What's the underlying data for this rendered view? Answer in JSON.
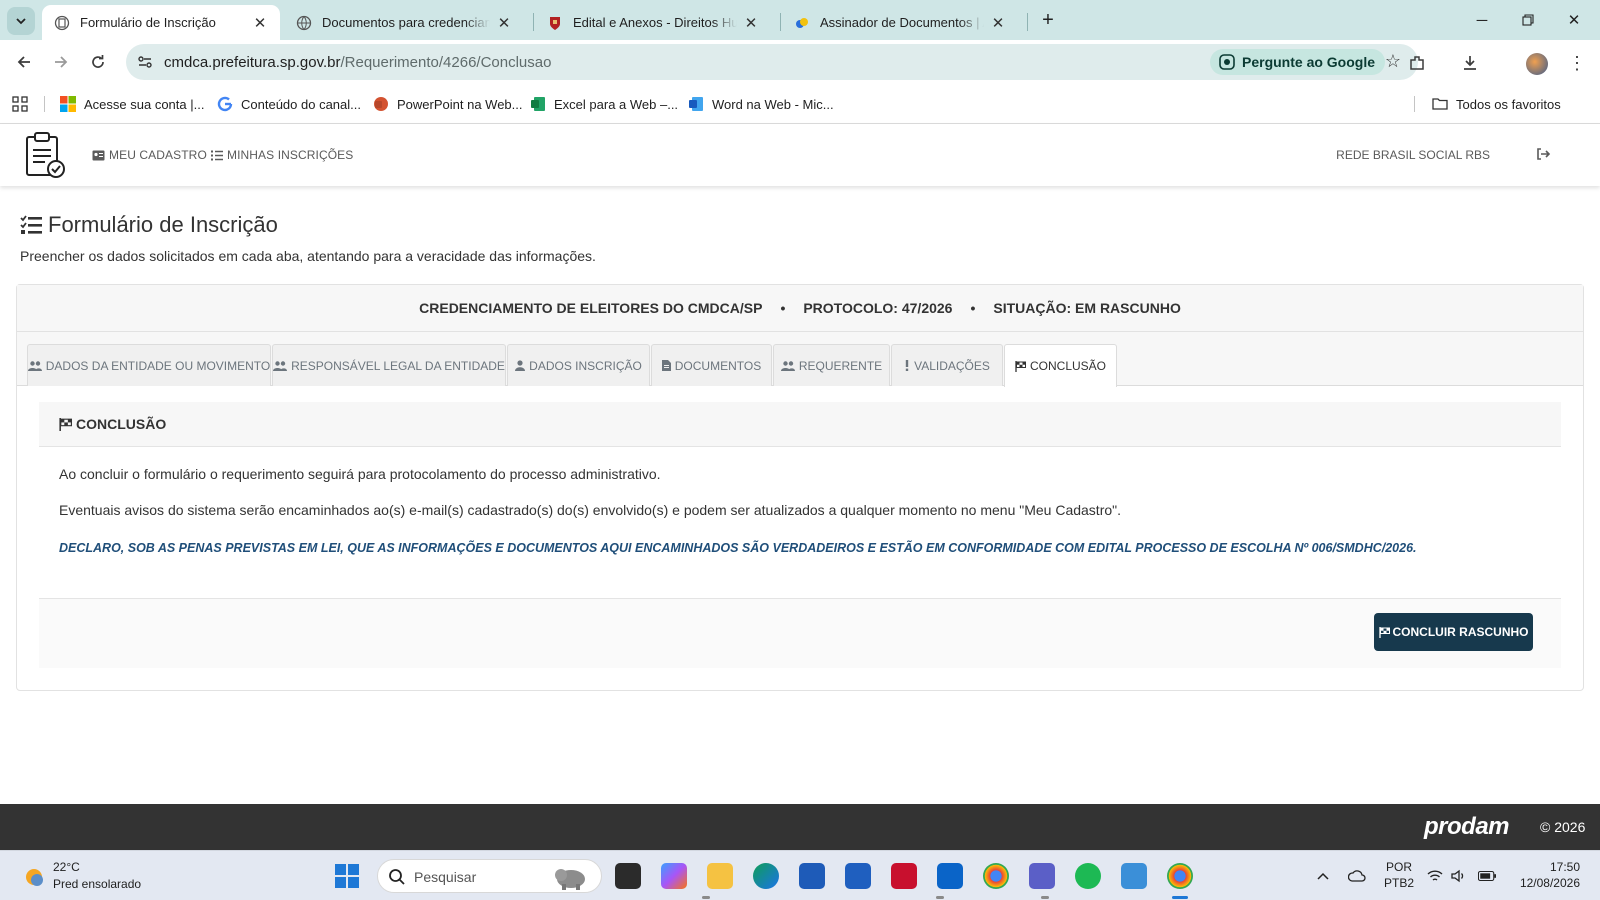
{
  "browser": {
    "tabs": [
      {
        "title": "Formulário de Inscrição",
        "active": true
      },
      {
        "title": "Documentos para credenciamento",
        "active": false
      },
      {
        "title": "Edital e Anexos - Direitos Humanos",
        "active": false
      },
      {
        "title": "Assinador de Documentos | Assinatura",
        "active": false
      }
    ],
    "url_host": "cmdca.prefeitura.sp.gov.br",
    "url_path": "/Requerimento/4266/Conclusao",
    "ask_google": "Pergunte ao Google",
    "bookmarks": [
      {
        "label": "Acesse sua conta |..."
      },
      {
        "label": "Conteúdo do canal..."
      },
      {
        "label": "PowerPoint na Web..."
      },
      {
        "label": "Excel para a Web –..."
      },
      {
        "label": "Word na Web - Mic..."
      }
    ],
    "all_bookmarks": "Todos os favoritos"
  },
  "site": {
    "nav": {
      "my_registration": "MEU CADASTRO",
      "my_subscriptions": "MINHAS INSCRIÇÕES",
      "user": "REDE BRASIL SOCIAL RBS"
    },
    "page_title": "Formulário de Inscrição",
    "page_subtitle": "Preencher os dados solicitados em cada aba, atentando para a veracidade das informações.",
    "header": {
      "process": "CREDENCIAMENTO DE ELEITORES DO CMDCA/SP",
      "sep": "•",
      "protocol": "PROTOCOLO: 47/2026",
      "status": "SITUAÇÃO: EM RASCUNHO"
    },
    "tabs": [
      {
        "label": "DADOS DA ENTIDADE OU MOVIMENTO",
        "icon": "users-icon"
      },
      {
        "label": "RESPONSÁVEL LEGAL DA ENTIDADE",
        "icon": "users-icon"
      },
      {
        "label": "DADOS INSCRIÇÃO",
        "icon": "user-icon"
      },
      {
        "label": "DOCUMENTOS",
        "icon": "file-icon"
      },
      {
        "label": "REQUERENTE",
        "icon": "users-icon"
      },
      {
        "label": "VALIDAÇÕES",
        "icon": "exclamation-icon"
      },
      {
        "label": "CONCLUSÃO",
        "icon": "flag-icon",
        "active": true
      }
    ],
    "conclusion": {
      "heading": "CONCLUSÃO",
      "paragraph1": "Ao concluir o formulário o requerimento seguirá para protocolamento do processo administrativo.",
      "paragraph2": "Eventuais avisos do sistema serão encaminhados ao(s) e-mail(s) cadastrado(s) do(s) envolvido(s) e podem ser atualizados a qualquer momento no menu \"Meu Cadastro\".",
      "declaration": "DECLARO, SOB AS PENAS PREVISTAS EM LEI, QUE AS INFORMAÇÕES E DOCUMENTOS AQUI ENCAMINHADOS SÃO VERDADEIROS E ESTÃO EM CONFORMIDADE COM EDITAL PROCESSO DE ESCOLHA Nº 006/SMDHC/2026.",
      "button": "CONCLUIR RASCUNHO"
    },
    "footer": {
      "logo_text": "prodam",
      "copyright": "© 2026"
    }
  },
  "taskbar": {
    "weather_temp": "22°C",
    "weather_desc": "Pred ensolarado",
    "search_placeholder": "Pesquisar",
    "lang_line1": "POR",
    "lang_line2": "PTB2",
    "time": "17:50",
    "date": "12/08/2026"
  },
  "colors": {
    "primary_button": "#17394d",
    "declaration_text": "#1f4e79",
    "footer_bg": "#333333",
    "tabbar_bg": "#cfe6e6"
  }
}
